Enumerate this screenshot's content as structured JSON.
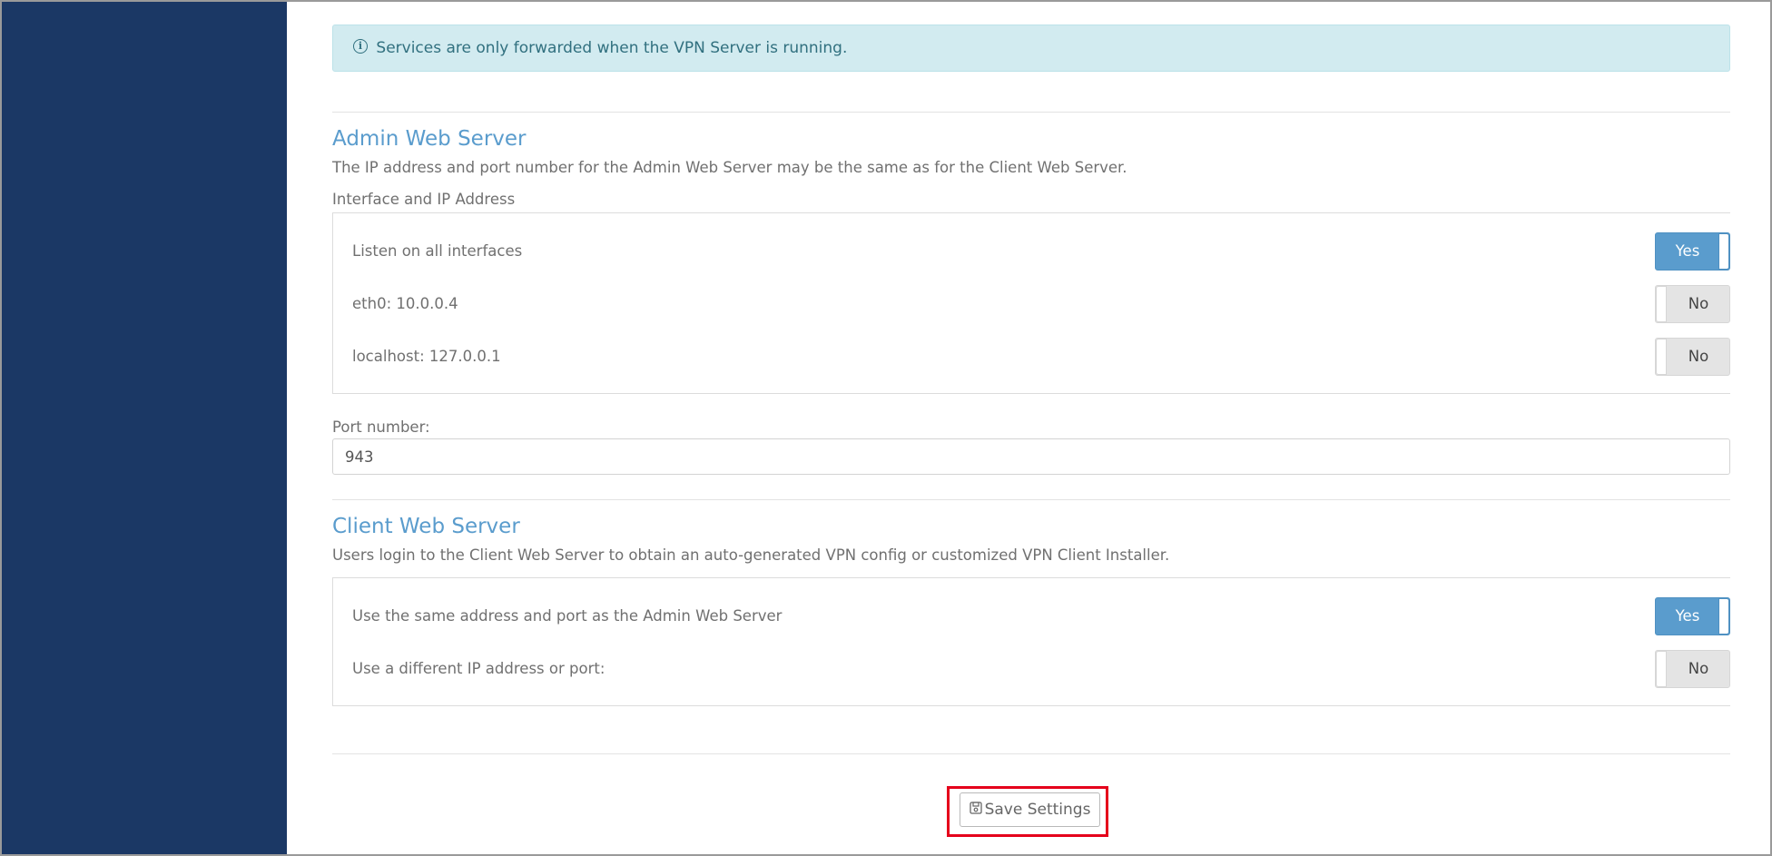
{
  "alert": {
    "text": "Services are only forwarded when the VPN Server is running."
  },
  "admin_web_server": {
    "title": "Admin Web Server",
    "description": "The IP address and port number for the Admin Web Server may be the same as for the Client Web Server.",
    "interface_label": "Interface and IP Address",
    "interfaces": [
      {
        "label": "Listen on all interfaces",
        "toggle": "Yes",
        "state": "on"
      },
      {
        "label": "eth0: 10.0.0.4",
        "toggle": "No",
        "state": "off"
      },
      {
        "label": "localhost: 127.0.0.1",
        "toggle": "No",
        "state": "off"
      }
    ],
    "port_label": "Port number:",
    "port_value": "943"
  },
  "client_web_server": {
    "title": "Client Web Server",
    "description": "Users login to the Client Web Server to obtain an auto-generated VPN config or customized VPN Client Installer.",
    "options": [
      {
        "label": "Use the same address and port as the Admin Web Server",
        "toggle": "Yes",
        "state": "on"
      },
      {
        "label": "Use a different IP address or port:",
        "toggle": "No",
        "state": "off"
      }
    ]
  },
  "actions": {
    "save_label": "Save Settings"
  },
  "colors": {
    "sidebar": "#1b3865",
    "accent": "#5a9ccd",
    "alert_bg": "#d2ebf0",
    "highlight": "#e5001b"
  }
}
